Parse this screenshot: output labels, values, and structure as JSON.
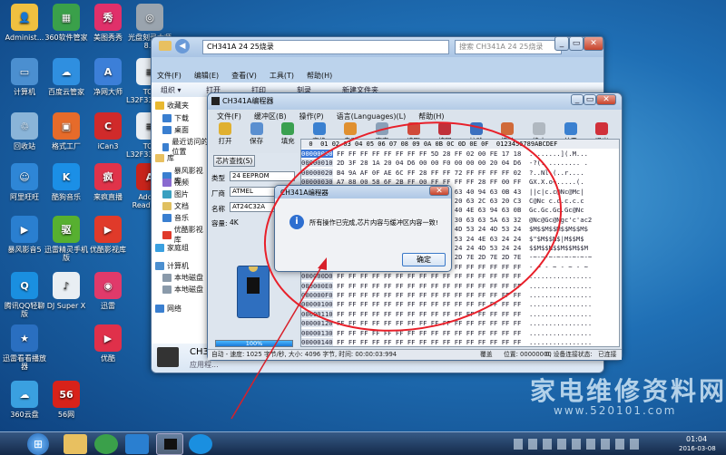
{
  "desktop": {
    "icons": [
      {
        "label": "Administ...",
        "color": "#f0c040",
        "glyph": "👤"
      },
      {
        "label": "360软件管家",
        "color": "#3aa04a",
        "glyph": "▦"
      },
      {
        "label": "美图秀秀",
        "color": "#e0306a",
        "glyph": "秀"
      },
      {
        "label": "光盘刻录大师 8.6",
        "color": "#9aa4ae",
        "glyph": "◎"
      },
      {
        "label": "计算机",
        "color": "#4b8fd0",
        "glyph": "▭"
      },
      {
        "label": "百度云管家",
        "color": "#2f8fe0",
        "glyph": "☁"
      },
      {
        "label": "净网大师",
        "color": "#3c7fd8",
        "glyph": "A"
      },
      {
        "label": "TCL L32F3320B...",
        "color": "#e9eef3",
        "glyph": "≡"
      },
      {
        "label": "回收站",
        "color": "#8ab4d8",
        "glyph": "♲"
      },
      {
        "label": "格式工厂",
        "color": "#e66b2a",
        "glyph": "▣"
      },
      {
        "label": "iCan3",
        "color": "#d02a2a",
        "glyph": "C"
      },
      {
        "label": "TCL L32F3320B...",
        "color": "#e9eef3",
        "glyph": "≡"
      },
      {
        "label": "阿里旺旺",
        "color": "#2e86d6",
        "glyph": "☺"
      },
      {
        "label": "酷狗音乐",
        "color": "#1b8fe6",
        "glyph": "K"
      },
      {
        "label": "来疯直播",
        "color": "#e0334a",
        "glyph": "疯"
      },
      {
        "label": "Adobe Reader XI",
        "color": "#c8241b",
        "glyph": "A"
      },
      {
        "label": "暴风影音5",
        "color": "#2a7fd0",
        "glyph": "▶"
      },
      {
        "label": "迅雷精灵手机版",
        "color": "#57b030",
        "glyph": "驱"
      },
      {
        "label": "优酷影视库",
        "color": "#e03a2a",
        "glyph": "▶"
      },
      {
        "label": "腾讯QQ轻聊版",
        "color": "#1a8fe0",
        "glyph": "Q"
      },
      {
        "label": "DJ Super X",
        "color": "#e9eef3",
        "glyph": "♪"
      },
      {
        "label": "迅雷",
        "color": "#e03a6a",
        "glyph": "◉"
      },
      {
        "label": "迅雷看看播放器",
        "color": "#2a6fc0",
        "glyph": "★"
      },
      {
        "label": "优酷",
        "color": "#e0304a",
        "glyph": "▶"
      },
      {
        "label": "360云盘",
        "color": "#3aa0e0",
        "glyph": "☁"
      },
      {
        "label": "56网",
        "color": "#d8221a",
        "glyph": "56"
      }
    ]
  },
  "explorer": {
    "title": "CH341A 24 25烧录",
    "address": "CH341A 24 25烧录",
    "search_placeholder": "搜索 CH341A 24 25烧录",
    "menu": [
      "文件(F)",
      "编辑(E)",
      "查看(V)",
      "工具(T)",
      "帮助(H)"
    ],
    "toolbar": [
      "组织 ▾",
      "打开",
      "打印",
      "刻录",
      "新建文件夹"
    ],
    "nav": [
      {
        "label": "收藏夹",
        "color": "#e8b830"
      },
      {
        "label": "下载",
        "color": "#3a7fd0"
      },
      {
        "label": "桌面",
        "color": "#3a7fd0"
      },
      {
        "label": "最近访问的位置",
        "color": "#3a7fd0"
      },
      {
        "label": "库",
        "color": "#e8c060"
      },
      {
        "label": "暴风影视库",
        "color": "#3a7fd0"
      },
      {
        "label": "视频",
        "color": "#8a6ad0"
      },
      {
        "label": "图片",
        "color": "#3aa0c0"
      },
      {
        "label": "文档",
        "color": "#e0c060"
      },
      {
        "label": "音乐",
        "color": "#3a7fd0"
      },
      {
        "label": "优酷影视库",
        "color": "#e03a2a"
      },
      {
        "label": "家庭组",
        "color": "#3aa0e0"
      },
      {
        "label": "计算机",
        "color": "#4b8fd0"
      },
      {
        "label": "本地磁盘",
        "color": "#8a9aaa"
      },
      {
        "label": "本地磁盘",
        "color": "#8a9aaa"
      },
      {
        "label": "网络",
        "color": "#3a7fd0"
      }
    ],
    "status_name": "CH3",
    "status_sub": "应用程..."
  },
  "programmer": {
    "title": "CH341A编程器",
    "menu": [
      "文件(F)",
      "缓冲区(B)",
      "操作(P)",
      "语言(Languages)(L)",
      "帮助(H)"
    ],
    "toolbar": [
      {
        "label": "打开",
        "color": "#e0b030"
      },
      {
        "label": "保存",
        "color": "#5a8fd0"
      },
      {
        "label": "填充",
        "color": "#3aa050"
      },
      {
        "label": "交换",
        "color": "#3a80d0"
      },
      {
        "label": "自动",
        "color": "#e09030"
      },
      {
        "label": "查空",
        "color": "#8aa0b8"
      },
      {
        "label": "读取",
        "color": "#d04a3a"
      },
      {
        "label": "编程",
        "color": "#c0303a"
      },
      {
        "label": "校验",
        "color": "#3a70c0"
      },
      {
        "label": "擦除",
        "color": "#d06a3a"
      },
      {
        "label": "终止",
        "color": "#b0b8c0"
      },
      {
        "label": "关于",
        "color": "#3a80d0"
      },
      {
        "label": "退出",
        "color": "#d0303a"
      }
    ],
    "chip_search": "芯片查找(S)",
    "type_label": "类型",
    "type_value": "24 EEPROM",
    "vendor_label": "厂商",
    "vendor_value": "ATMEL",
    "name_label": "名称",
    "name_value": "AT24C32A",
    "capacity_label": "容量:",
    "capacity_value": "4K",
    "progress_text": "100%",
    "progress": 1.0,
    "hex_header": "  0  01 02 03 04 05 06 07 08 09 0A 0B 0C 0D 0E 0F  0123456789ABCDEF",
    "hex_rows": [
      {
        "addr": "00000000",
        "bytes": "FF FF FF FF FF FF FF FF 5D 28 FF 02 00 FE 17 18",
        "ascii": "........](.M..."
      },
      {
        "addr": "00000010",
        "bytes": "2D 3F 28 1A 20 04 D6 00 00 F0 00 00 00 20 04 D6",
        "ascii": "-?(. ........ ."
      },
      {
        "addr": "00000020",
        "bytes": "B4 9A AF 0F AE 6C FF 28 FF FF 72 FF FF FF FF 02",
        "ascii": "?..Nl.(..r...."
      },
      {
        "addr": "00000030",
        "bytes": "A7 88 00 58 6F 2B FF 00 FF FF FF FF 28 FF 00 FF",
        "ascii": "GX.X.o+.....(."
      },
      {
        "addr": "00000040",
        "bytes": "7C 7C 63 20 63 20 63 20 40 4E 63 40 94 63 0B 43",
        "ascii": "||c|c.c@Nc@Mc|"
      },
      {
        "addr": "00000050",
        "bytes": "43 40 94 63 20 63 20 63 20 63 20 63 2C 63 20 C3",
        "ascii": "C@Nc c.c.c.c.c"
      },
      {
        "addr": "00000060",
        "bytes": "47 63 20 63 20 63 20 C4 63 30 40 4E 63 94 63 0B",
        "ascii": "Gc.Gc.Gc.Gc@Nc"
      },
      {
        "addr": "00000070",
        "bytes": "4E 63 40 94 43 47 63 20 4E 63 30 63 63 5A 63 32",
        "ascii": "@Nc@Gc@Ngc'c'ac2"
      },
      {
        "addr": "00000080",
        "bytes": "24 4D 53 24 4D 53 24 4D 53 24 4D 53 24 4D 53 24",
        "ascii": "$M$$M$$M$$M$$M$"
      },
      {
        "addr": "00000090",
        "bytes": "24 24 53 7C 24 24 4D 53 24 24 53 24 4E 63 24 24",
        "ascii": "$\"$M$$N$|M$$M$"
      },
      {
        "addr": "000000A0",
        "bytes": "24 24 53 24 24 53 24 24 24 53 24 24 4D 53 24 24",
        "ascii": "$$M$$N$$M$$M$$M"
      },
      {
        "addr": "000000B0",
        "bytes": "2D 7E 2D 7E 2D 7E 2D 7E 2D 7E 2D 7E 2D 7E 2D 7E",
        "ascii": "-~-~-~-~-~-~-~-~"
      },
      {
        "addr": "000000C0",
        "bytes": "FF FF FF FF FF FF FF FF FF FF FF FF FF FF FF FF",
        "ascii": "- ~ - ~ - ~ - ~"
      },
      {
        "addr": "000000D0",
        "bytes": "FF FF FF FF FF FF FF FF FF FF FF FF FF FF FF FF",
        "ascii": "................"
      },
      {
        "addr": "000000E0",
        "bytes": "FF FF FF FF FF FF FF FF FF FF FF FF FF FF FF FF",
        "ascii": "................"
      },
      {
        "addr": "000000F0",
        "bytes": "FF FF FF FF FF FF FF FF FF FF FF FF FF FF FF FF",
        "ascii": "................"
      },
      {
        "addr": "00000100",
        "bytes": "FF FF FF FF FF FF FF FF FF FF FF FF FF FF FF FF",
        "ascii": "................"
      },
      {
        "addr": "00000110",
        "bytes": "FF FF FF FF FF FF FF FF FF FF FF FF FF FF FF FF",
        "ascii": "................"
      },
      {
        "addr": "00000120",
        "bytes": "FF FF FF FF FF FF FF FF FF FF FF FF FF FF FF FF",
        "ascii": "................"
      },
      {
        "addr": "00000130",
        "bytes": "FF FF FF FF FF FF FF FF FF FF FF FF FF FF FF FF",
        "ascii": "................"
      },
      {
        "addr": "00000140",
        "bytes": "FF FF FF FF FF FF FF FF FF FF FF FF FF FF FF FF",
        "ascii": "................"
      }
    ],
    "status": [
      "自动 - 速度: 1025 字节/秒, 大小: 4096 字节, 时间: 00:00:03:994",
      "覆盖",
      "位置: 00000000",
      "0, 设备连接状态:",
      "已连接"
    ]
  },
  "dialog": {
    "title": "CH341A编程器",
    "message": "所有操作已完成,芯片内容与缓冲区内容一致!",
    "ok": "确定"
  },
  "watermark_text": "家电维修资料网",
  "watermark_url": "www.520101.com",
  "taskbar": {
    "start": "⊞",
    "time": "01:04",
    "date": "2016-03-08"
  }
}
